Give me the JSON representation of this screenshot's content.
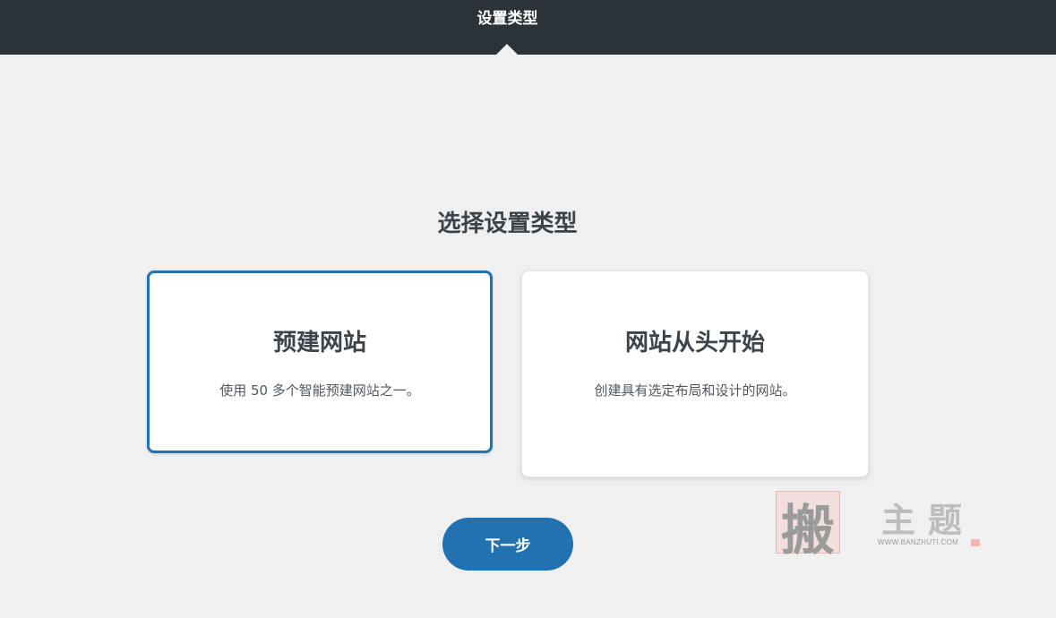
{
  "header": {
    "step_title": "设置类型"
  },
  "main": {
    "heading": "选择设置类型",
    "options": [
      {
        "title": "预建网站",
        "description": "使用 50 多个智能预建网站之一。",
        "selected": true
      },
      {
        "title": "网站从头开始",
        "description": "创建具有选定布局和设计的网站。",
        "selected": false
      }
    ],
    "next_label": "下一步"
  },
  "watermark": {
    "chars": [
      "搬",
      "主",
      "题"
    ],
    "url": "WWW.BANZHUTI.COM"
  },
  "colors": {
    "topbar": "#2c3338",
    "background": "#f0f0f0",
    "accent": "#2271b1",
    "card": "#ffffff"
  }
}
